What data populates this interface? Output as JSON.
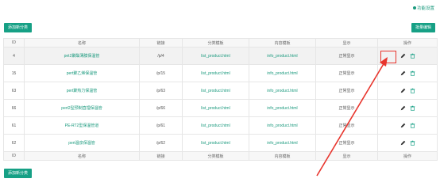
{
  "header": {
    "top_link": "功能设置"
  },
  "toolbar": {
    "add_category": "添加新分类",
    "batch_edit": "批量编辑"
  },
  "table": {
    "columns": [
      "ID",
      "名称",
      "链接",
      "分类模板",
      "内容模板",
      "显示",
      "操作"
    ],
    "rows": [
      {
        "id": "4",
        "name": "pet2聚酯薄膜保温管",
        "link": "/p/4",
        "list_tpl": "list_product.html",
        "info_tpl": "info_product.html",
        "display": "正常显示"
      },
      {
        "id": "15",
        "name": "pert聚乙烯保温管",
        "link": "/p/15",
        "list_tpl": "list_product.html",
        "info_tpl": "info_product.html",
        "display": "正常显示"
      },
      {
        "id": "63",
        "name": "pert聚热力保温管",
        "link": "/p/63",
        "list_tpl": "list_product.html",
        "info_tpl": "info_product.html",
        "display": "正常显示"
      },
      {
        "id": "66",
        "name": "pert2型预制直埋保温管",
        "link": "/p/66",
        "list_tpl": "list_product.html",
        "info_tpl": "info_product.html",
        "display": "正常显示"
      },
      {
        "id": "61",
        "name": "PE-RT2型保温管道",
        "link": "/p/61",
        "list_tpl": "list_product.html",
        "info_tpl": "info_product.html",
        "display": "正常显示"
      },
      {
        "id": "62",
        "name": "pert温泉保温管",
        "link": "/p/62",
        "list_tpl": "list_product.html",
        "info_tpl": "info_product.html",
        "display": "正常显示"
      }
    ]
  },
  "footer_toolbar": {
    "add_category": "添加新分类"
  },
  "colors": {
    "accent": "#16a085",
    "link": "#1b9a7e",
    "highlight": "#e8352d"
  },
  "icons": {
    "edit": "pencil-icon",
    "delete": "trash-icon",
    "settings": "gear-icon"
  }
}
